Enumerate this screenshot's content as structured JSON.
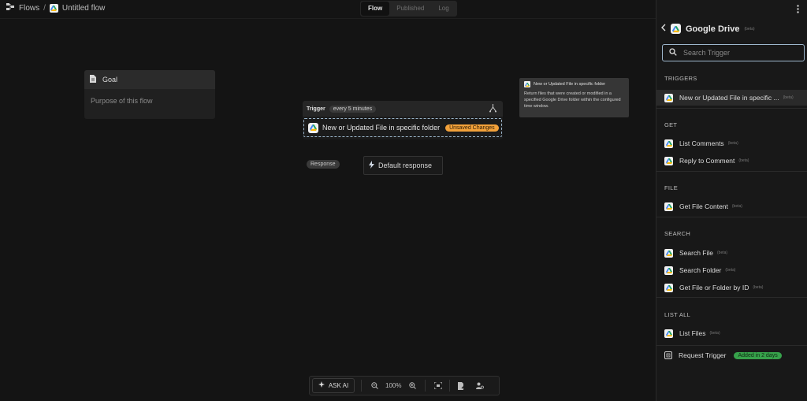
{
  "breadcrumb": {
    "flows_label": "Flows",
    "separator": "/",
    "flow_title": "Untitled flow"
  },
  "tabs": [
    {
      "label": "Flow",
      "active": true
    },
    {
      "label": "Published",
      "active": false
    },
    {
      "label": "Log",
      "active": false
    }
  ],
  "goal": {
    "title": "Goal",
    "placeholder": "Purpose of this flow"
  },
  "trigger": {
    "label": "Trigger",
    "schedule": "every 5 minutes",
    "step_name": "New or Updated File in specific folder",
    "status": "Unsaved Changes"
  },
  "response": {
    "pill": "Response",
    "default_label": "Default response"
  },
  "tooltip": {
    "title": "New or Updated File in specific folder",
    "description": "Return files that were created or modified in a specified Google Drive folder within the configured time window."
  },
  "toolbar": {
    "ask_ai": "ASK AI",
    "zoom": "100%"
  },
  "panel": {
    "title": "Google Drive",
    "beta": "(beta)",
    "search_placeholder": "Search Trigger",
    "sections": {
      "triggers": "TRIGGERS",
      "get": "GET",
      "file": "FILE",
      "search": "SEARCH",
      "list_all": "LIST ALL"
    },
    "items": {
      "trigger_new_updated": "New or Updated File in specific ...",
      "list_comments": "List Comments",
      "reply_to_comment": "Reply to Comment",
      "get_file_content": "Get File Content",
      "search_file": "Search File",
      "search_folder": "Search Folder",
      "get_file_or_folder": "Get File or Folder by ID",
      "list_files": "List Files",
      "request_trigger": "Request Trigger"
    },
    "request_badge": "Added in 2 days"
  },
  "colors": {
    "accent_unsaved": "#f2a13a",
    "accent_added": "#37a24b",
    "focus_border": "#9db6cc"
  }
}
